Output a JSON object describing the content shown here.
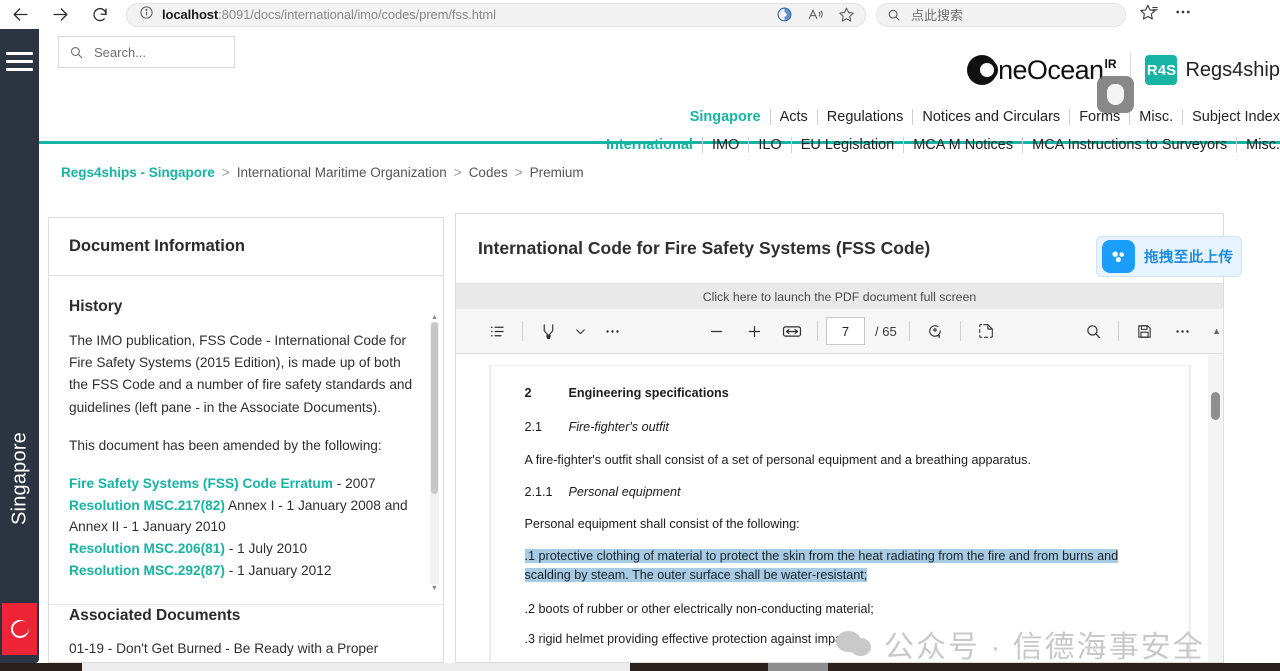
{
  "browser": {
    "back_icon": "arrow-left-icon",
    "forward_icon": "arrow-right-icon",
    "reload_icon": "reload-icon",
    "info_icon": "info-icon",
    "url_host": "localhost",
    "url_rest": ":8091/docs/international/imo/codes/prem/fss.html",
    "split_icon": "browser-essentials-icon",
    "read_aloud_icon": "read-aloud-icon",
    "favorite_icon": "star-icon",
    "search_placeholder": "点此搜索",
    "collections_icon": "collections-icon",
    "settings_icon": "more-options-icon"
  },
  "rail": {
    "menu_icon": "hamburger-menu-icon",
    "label": "Singapore",
    "flag_icon": "singapore-flag-icon"
  },
  "site": {
    "search_placeholder": "Search...",
    "search_icon": "search-icon",
    "brand": {
      "ocean_name": "neOcean",
      "ocean_sup": "lR",
      "badge": "R4S",
      "product": "Regs4ship"
    },
    "nav_rows": [
      {
        "country": "Singapore",
        "items": [
          "Acts",
          "Regulations",
          "Notices and Circulars",
          "Forms",
          "Misc.",
          "Subject Index"
        ]
      },
      {
        "country": "International",
        "items": [
          "IMO",
          "ILO",
          "EU Legislation",
          "MCA M Notices",
          "MCA Instructions to Surveyors",
          "Misc."
        ]
      }
    ]
  },
  "breadcrumb": {
    "home": "Regs4ships - Singapore",
    "separator": ">",
    "segments": [
      "International Maritime Organization",
      "Codes",
      "Premium"
    ]
  },
  "document_info": {
    "panel_title": "Document Information",
    "history_heading": "History",
    "history_text": "The IMO publication, FSS Code - International Code for Fire Safety Systems (2015 Edition), is made up of both the FSS Code and a number of fire safety standards and guidelines (left pane - in the Associate Documents).",
    "amended_intro": "This document has been amended by the following:",
    "amendments": [
      {
        "link": "Fire Safety Systems (FSS) Code Erratum",
        "detail": " - 2007"
      },
      {
        "link": "Resolution MSC.217(82)",
        "detail": " Annex  I - 1 January 2008 and Annex II - 1 January 2010"
      },
      {
        "link": "Resolution MSC.206(81)",
        "detail": " - 1 July 2010"
      },
      {
        "link": "Resolution MSC.292(87)",
        "detail": " - 1 January 2012"
      }
    ],
    "associated_heading": "Associated Documents",
    "associated_items": [
      "01-19 - Don't Get Burned - Be Ready with a Proper"
    ]
  },
  "viewer": {
    "title": "International Code for Fire Safety Systems (FSS Code)",
    "launch_bar": "Click here to launch the PDF document full screen",
    "toolbar": {
      "toc_icon": "table-of-contents-icon",
      "highlight_icon": "highlighter-icon",
      "highlight_chevron_icon": "chevron-down-icon",
      "more_icon": "ellipsis-icon",
      "zoom_out_icon": "minus-icon",
      "zoom_in_icon": "plus-icon",
      "fit_width_icon": "fit-to-width-icon",
      "page_value": "7",
      "page_total": "/ 65",
      "rotate_icon": "rotate-icon",
      "select_text_icon": "select-text-icon",
      "search_icon": "search-icon",
      "save_icon": "save-icon",
      "settings_icon": "more-settings-icon",
      "scroll_up_icon": "caret-up-icon"
    },
    "page_content": {
      "section_num": "2",
      "section_title": "Engineering specifications",
      "sub_num": "2.1",
      "sub_title": "Fire-fighter's outfit",
      "para1": "A fire-fighter's outfit shall consist of a set of personal equipment and a breathing apparatus.",
      "sub2_num": "2.1.1",
      "sub2_title": "Personal equipment",
      "para2": "Personal equipment shall consist of the following:",
      "item1": ".1 protective clothing of material to protect the skin from the heat radiating from the fire and from burns and scalding by steam. The outer surface shall be water-resistant;",
      "item2": ".2 boots of rubber or other electrically non-conducting material;",
      "item3": ".3 rigid helmet providing effective protection against impact;"
    }
  },
  "upload_widget": {
    "icon": "wechat-cloud-upload-icon",
    "label": "拖拽至此上传"
  },
  "watermark": {
    "icon": "wechat-bubble-icon",
    "text": "公众号 · 信德海事安全"
  },
  "colors": {
    "accent_teal": "#17b3a3",
    "rail_dark": "#2b3440",
    "flag_red": "#ee2536",
    "highlight_blue": "#a8cbe3",
    "upload_blue": "#1b9dfb"
  }
}
